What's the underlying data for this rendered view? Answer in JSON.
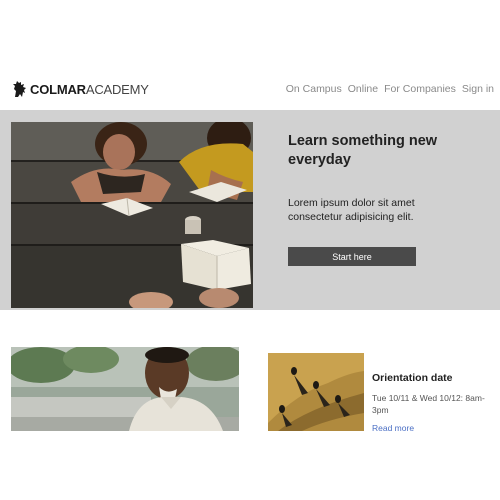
{
  "brand": {
    "name_bold": "COLMAR",
    "name_light": "ACADEMY",
    "logo_icon": "lion-rampant-icon"
  },
  "nav": {
    "items": [
      {
        "label": "On Campus"
      },
      {
        "label": "Online"
      },
      {
        "label": "For Companies"
      },
      {
        "label": "Sign in"
      }
    ]
  },
  "hero": {
    "title": "Learn something new everyday",
    "body": "Lorem ipsum dolor sit amet consectetur adipisicing elit.",
    "cta_label": "Start here",
    "background_color": "#d1d1d1",
    "cta_color": "#4a4a4a"
  },
  "event": {
    "title": "Orientation date",
    "date_text": "Tue 10/11 & Wed 10/12: 8am-3pm",
    "link_label": "Read more",
    "link_color": "#4b6fc4"
  }
}
